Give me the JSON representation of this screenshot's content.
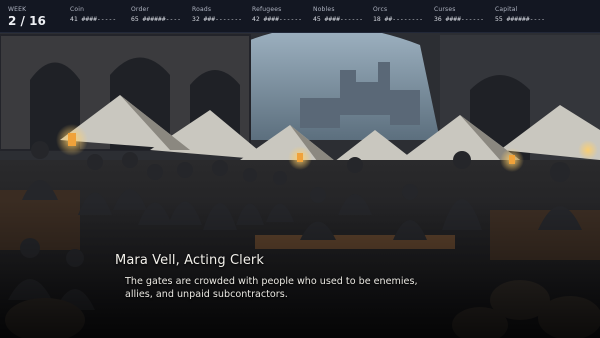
{
  "week": {
    "label": "WEEK",
    "value": "2 / 16"
  },
  "stats": [
    {
      "label": "Coin",
      "value": "41 ####-----"
    },
    {
      "label": "Order",
      "value": "65 ######----"
    },
    {
      "label": "Roads",
      "value": "32 ###-------"
    },
    {
      "label": "Refugees",
      "value": "42 ####------"
    },
    {
      "label": "Nobles",
      "value": "45 ####------"
    },
    {
      "label": "Orcs",
      "value": "18 ##--------"
    },
    {
      "label": "Curses",
      "value": "36 ####------"
    },
    {
      "label": "Capital",
      "value": "55 ######----"
    }
  ],
  "dialogue": {
    "speaker": "Mara Vell, Acting Clerk",
    "line1": "The gates are crowded with people who used to be enemies,",
    "line2": "allies, and unpaid subcontractors."
  },
  "colors": {
    "bar_bg": "#131722",
    "text": "#d5d8df",
    "sky": "#8ea6b8",
    "lantern": "#f0a23a"
  }
}
